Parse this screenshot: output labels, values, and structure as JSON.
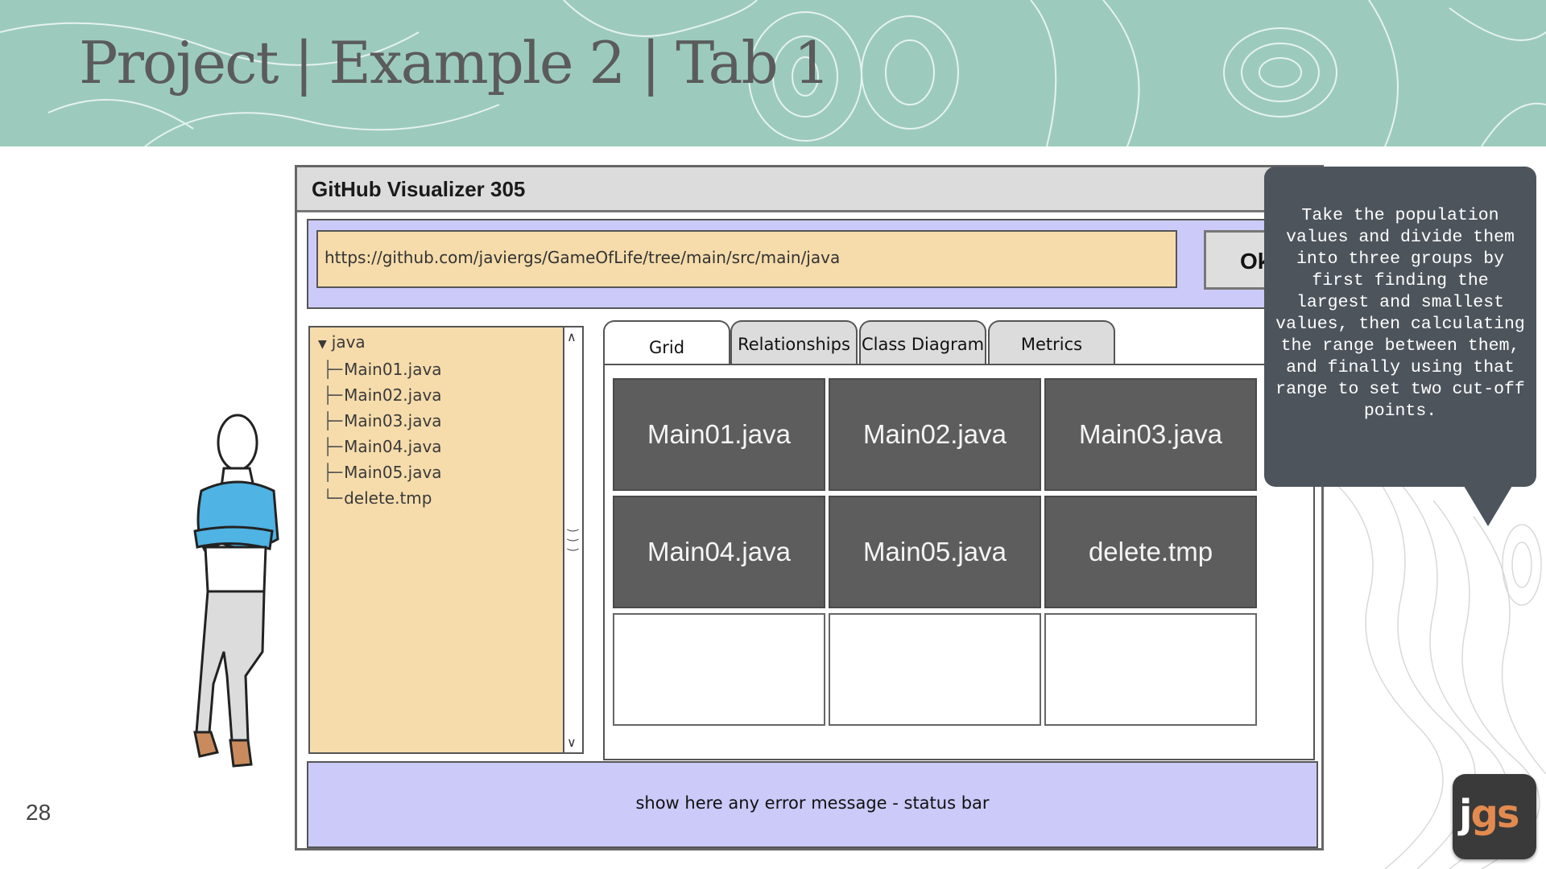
{
  "slide": {
    "title": "Project | Example 2 | Tab 1",
    "page_number": "28",
    "header_color": "#9ccbbd"
  },
  "window": {
    "title": "GitHub Visualizer 305",
    "url_value": "https://github.com/javiergs/GameOfLife/tree/main/src/main/java",
    "ok_label": "Ok"
  },
  "tree": {
    "root": "java",
    "items": [
      {
        "branch": "├─",
        "label": "Main01.java"
      },
      {
        "branch": "├─",
        "label": "Main02.java"
      },
      {
        "branch": "├─",
        "label": "Main03.java"
      },
      {
        "branch": "├─",
        "label": "Main04.java"
      },
      {
        "branch": "├─",
        "label": "Main05.java"
      },
      {
        "branch": "└─",
        "label": "delete.tmp"
      }
    ]
  },
  "tabs": [
    {
      "label": "Grid",
      "active": true
    },
    {
      "label": "Relationships",
      "active": false
    },
    {
      "label": "Class Diagram",
      "active": false
    },
    {
      "label": "Metrics",
      "active": false
    }
  ],
  "grid": {
    "cells": [
      "Main01.java",
      "Main02.java",
      "Main03.java",
      "Main04.java",
      "Main05.java",
      "delete.tmp",
      "",
      "",
      ""
    ],
    "filled_color": "#5d5d5d"
  },
  "status_bar": {
    "text": "show here any error message - status bar"
  },
  "callout": {
    "text": "Take the population values and divide them into three groups by first finding the largest and smallest values, then calculating the range between them, and finally using that range to set two cut-off points."
  },
  "logo": {
    "j": "j",
    "gs": "gs"
  }
}
